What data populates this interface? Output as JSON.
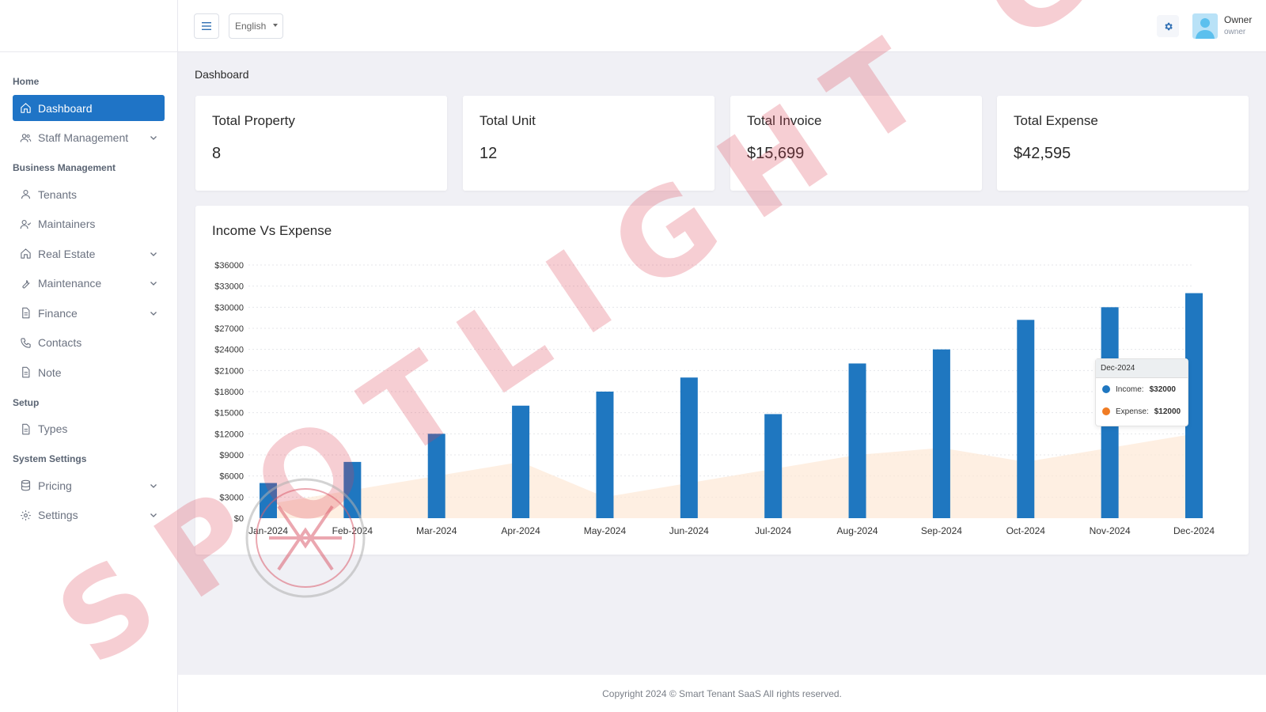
{
  "sidebar": {
    "sections": [
      {
        "title": "Home",
        "items": [
          {
            "label": "Dashboard",
            "icon": "home-icon",
            "active": true,
            "chevron": false
          },
          {
            "label": "Staff Management",
            "icon": "users-icon",
            "active": false,
            "chevron": true
          }
        ]
      },
      {
        "title": "Business Management",
        "items": [
          {
            "label": "Tenants",
            "icon": "user-icon",
            "active": false,
            "chevron": false
          },
          {
            "label": "Maintainers",
            "icon": "user-check-icon",
            "active": false,
            "chevron": false
          },
          {
            "label": "Real Estate",
            "icon": "home-icon",
            "active": false,
            "chevron": true
          },
          {
            "label": "Maintenance",
            "icon": "wrench-icon",
            "active": false,
            "chevron": true
          },
          {
            "label": "Finance",
            "icon": "file-icon",
            "active": false,
            "chevron": true
          },
          {
            "label": "Contacts",
            "icon": "phone-icon",
            "active": false,
            "chevron": false
          },
          {
            "label": "Note",
            "icon": "file-icon",
            "active": false,
            "chevron": false
          }
        ]
      },
      {
        "title": "Setup",
        "items": [
          {
            "label": "Types",
            "icon": "file-icon",
            "active": false,
            "chevron": false
          }
        ]
      },
      {
        "title": "System Settings",
        "items": [
          {
            "label": "Pricing",
            "icon": "database-icon",
            "active": false,
            "chevron": true
          },
          {
            "label": "Settings",
            "icon": "gear-icon",
            "active": false,
            "chevron": true
          }
        ]
      }
    ]
  },
  "topbar": {
    "language": "English",
    "user_name": "Owner",
    "user_role": "owner"
  },
  "breadcrumb": "Dashboard",
  "cards": [
    {
      "title": "Total Property",
      "value": "8"
    },
    {
      "title": "Total Unit",
      "value": "12"
    },
    {
      "title": "Total Invoice",
      "value": "$15,699"
    },
    {
      "title": "Total Expense",
      "value": "$42,595"
    }
  ],
  "chart_data": {
    "type": "bar",
    "title": "Income Vs Expense",
    "categories": [
      "Jan-2024",
      "Feb-2024",
      "Mar-2024",
      "Apr-2024",
      "May-2024",
      "Jun-2024",
      "Jul-2024",
      "Aug-2024",
      "Sep-2024",
      "Oct-2024",
      "Nov-2024",
      "Dec-2024"
    ],
    "series": [
      {
        "name": "Income",
        "type": "bar",
        "color": "#1f77c0",
        "values": [
          5000,
          8000,
          12000,
          16000,
          18000,
          20000,
          14800,
          22000,
          24000,
          28200,
          30000,
          32000
        ]
      },
      {
        "name": "Expense",
        "type": "area",
        "color": "#f28f3b",
        "values": [
          2000,
          4000,
          6000,
          8000,
          3000,
          5000,
          7000,
          9000,
          10000,
          8000,
          10000,
          12000
        ]
      }
    ],
    "yticks": [
      "$0",
      "$3000",
      "$6000",
      "$9000",
      "$12000",
      "$15000",
      "$18000",
      "$21000",
      "$24000",
      "$27000",
      "$30000",
      "$33000",
      "$36000"
    ],
    "ylim": [
      0,
      36000
    ],
    "grid": true
  },
  "tooltip": {
    "header": "Dec-2024",
    "rows": [
      {
        "label": "Income:",
        "value": "$32000",
        "color": "#1f77c0"
      },
      {
        "label": "Expense:",
        "value": "$12000",
        "color": "#f07c24"
      }
    ]
  },
  "footer": "Copyright 2024 © Smart Tenant SaaS All rights reserved.",
  "watermark": {
    "text": "SPOTLIGHT GB"
  }
}
